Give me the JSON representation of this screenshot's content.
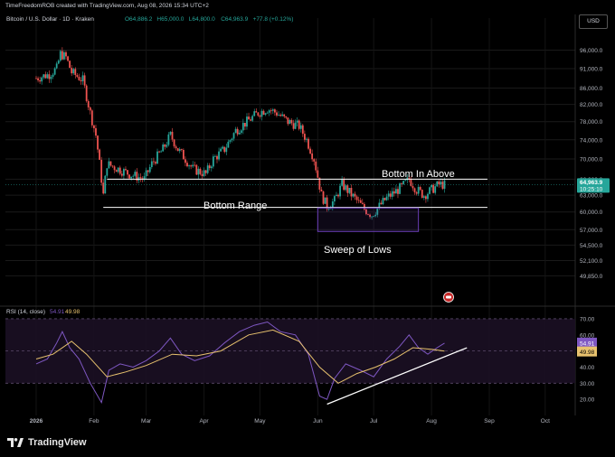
{
  "attribution": "TimeFreedomROB created with TradingView.com, Aug 08, 2026 15:34 UTC+2",
  "currency_button": "USD",
  "legend": {
    "symbol": "Bitcoin / U.S. Dollar · 1D · Kraken",
    "open": "O64,886.2",
    "high": "H65,000.0",
    "low": "L64,800.0",
    "close": "C64,963.9",
    "change": "+77.8 (+0.12%)"
  },
  "price_label": {
    "price": "64,963.9",
    "countdown": "10:25:10"
  },
  "rsi_legend": {
    "name": "RSI (14, close)",
    "rsi_value": "54.91",
    "ma_value": "49.98"
  },
  "rsi_labels": {
    "rsi": "54.91",
    "ma": "49.98"
  },
  "annotations": {
    "bottom_in_above": "Bottom In Above",
    "bottom_range": "Bottom Range",
    "sweep_of_lows": "Sweep of Lows"
  },
  "footer": {
    "brand": "TradingView"
  },
  "colors": {
    "up": "#26a69a",
    "down": "#ef5350",
    "rsi_line": "#7e57c2",
    "rsi_ma": "#e8c26e",
    "sweep_box": "#6b3fb8",
    "price_tag": "#26a69a",
    "rsi_tag": "#7e57c2",
    "ma_tag": "#e8c26e"
  },
  "chart_data": [
    {
      "type": "candlestick",
      "y_scale": "log",
      "ylim": [
        46000,
        100000
      ],
      "y_ticks": [
        "96,000.0",
        "91,000.0",
        "86,000.0",
        "82,000.0",
        "78,000.0",
        "74,000.0",
        "70,000.0",
        "66,000.0",
        "63,000.0",
        "60,000.0",
        "57,000.0",
        "54,500.0",
        "52,100.0",
        "49,850.0"
      ],
      "x_ticks": [
        "2026",
        "Feb",
        "Mar",
        "Apr",
        "May",
        "Jun",
        "Jul",
        "Aug",
        "Sep",
        "Oct"
      ],
      "path_points": [
        {
          "d": "2026-01-01",
          "v": 88500
        },
        {
          "d": "2026-01-08",
          "v": 89500
        },
        {
          "d": "2026-01-12",
          "v": 91000
        },
        {
          "d": "2026-01-14",
          "v": 95000
        },
        {
          "d": "2026-01-17",
          "v": 94000
        },
        {
          "d": "2026-01-20",
          "v": 90000
        },
        {
          "d": "2026-01-26",
          "v": 88000
        },
        {
          "d": "2026-01-30",
          "v": 80000
        },
        {
          "d": "2026-02-02",
          "v": 75000
        },
        {
          "d": "2026-02-06",
          "v": 63000
        },
        {
          "d": "2026-02-08",
          "v": 69000
        },
        {
          "d": "2026-02-14",
          "v": 68000
        },
        {
          "d": "2026-02-20",
          "v": 67000
        },
        {
          "d": "2026-02-28",
          "v": 66000
        },
        {
          "d": "2026-03-04",
          "v": 69000
        },
        {
          "d": "2026-03-10",
          "v": 72000
        },
        {
          "d": "2026-03-14",
          "v": 75000
        },
        {
          "d": "2026-03-18",
          "v": 72000
        },
        {
          "d": "2026-03-26",
          "v": 68000
        },
        {
          "d": "2026-04-02",
          "v": 67000
        },
        {
          "d": "2026-04-06",
          "v": 70000
        },
        {
          "d": "2026-04-12",
          "v": 72000
        },
        {
          "d": "2026-04-18",
          "v": 76000
        },
        {
          "d": "2026-04-24",
          "v": 78000
        },
        {
          "d": "2026-04-30",
          "v": 80000
        },
        {
          "d": "2026-05-05",
          "v": 81000
        },
        {
          "d": "2026-05-10",
          "v": 80000
        },
        {
          "d": "2026-05-16",
          "v": 78000
        },
        {
          "d": "2026-05-22",
          "v": 77000
        },
        {
          "d": "2026-05-26",
          "v": 74000
        },
        {
          "d": "2026-05-30",
          "v": 70000
        },
        {
          "d": "2026-06-03",
          "v": 63000
        },
        {
          "d": "2026-06-06",
          "v": 61000
        },
        {
          "d": "2026-06-10",
          "v": 62000
        },
        {
          "d": "2026-06-14",
          "v": 65000
        },
        {
          "d": "2026-06-18",
          "v": 63500
        },
        {
          "d": "2026-06-22",
          "v": 62000
        },
        {
          "d": "2026-06-26",
          "v": 60500
        },
        {
          "d": "2026-06-30",
          "v": 59500
        },
        {
          "d": "2026-07-04",
          "v": 61000
        },
        {
          "d": "2026-07-08",
          "v": 62500
        },
        {
          "d": "2026-07-12",
          "v": 63500
        },
        {
          "d": "2026-07-16",
          "v": 64500
        },
        {
          "d": "2026-07-20",
          "v": 66000
        },
        {
          "d": "2026-07-24",
          "v": 64000
        },
        {
          "d": "2026-07-28",
          "v": 63000
        },
        {
          "d": "2026-08-01",
          "v": 64000
        },
        {
          "d": "2026-08-05",
          "v": 65000
        },
        {
          "d": "2026-08-08",
          "v": 64963.9
        }
      ],
      "levels": [
        {
          "name": "bottom-in-above-line",
          "price": 66000,
          "from": "2026-02-08",
          "to": "2026-08-31"
        },
        {
          "name": "bottom-range-line",
          "price": 60800,
          "from": "2026-02-06",
          "to": "2026-08-31"
        }
      ],
      "sweep_box": {
        "from": "2026-06-01",
        "to": "2026-07-25",
        "top": 60700,
        "bottom": 56700
      }
    },
    {
      "type": "line",
      "title": "RSI (14, close)",
      "ylim": [
        10,
        75
      ],
      "y_ticks": [
        70,
        60,
        50,
        40,
        30,
        20
      ],
      "bands": [
        30,
        50,
        70
      ],
      "series": [
        {
          "name": "RSI",
          "points": [
            {
              "d": "2026-01-01",
              "v": 42
            },
            {
              "d": "2026-01-07",
              "v": 45
            },
            {
              "d": "2026-01-12",
              "v": 55
            },
            {
              "d": "2026-01-15",
              "v": 62
            },
            {
              "d": "2026-01-19",
              "v": 52
            },
            {
              "d": "2026-01-24",
              "v": 45
            },
            {
              "d": "2026-01-30",
              "v": 30
            },
            {
              "d": "2026-02-05",
              "v": 18
            },
            {
              "d": "2026-02-09",
              "v": 38
            },
            {
              "d": "2026-02-15",
              "v": 42
            },
            {
              "d": "2026-02-22",
              "v": 40
            },
            {
              "d": "2026-03-01",
              "v": 44
            },
            {
              "d": "2026-03-08",
              "v": 50
            },
            {
              "d": "2026-03-14",
              "v": 58
            },
            {
              "d": "2026-03-20",
              "v": 48
            },
            {
              "d": "2026-03-27",
              "v": 44
            },
            {
              "d": "2026-04-04",
              "v": 47
            },
            {
              "d": "2026-04-12",
              "v": 55
            },
            {
              "d": "2026-04-20",
              "v": 62
            },
            {
              "d": "2026-04-28",
              "v": 66
            },
            {
              "d": "2026-05-05",
              "v": 68
            },
            {
              "d": "2026-05-12",
              "v": 62
            },
            {
              "d": "2026-05-20",
              "v": 60
            },
            {
              "d": "2026-05-27",
              "v": 48
            },
            {
              "d": "2026-06-02",
              "v": 22
            },
            {
              "d": "2026-06-06",
              "v": 20
            },
            {
              "d": "2026-06-10",
              "v": 33
            },
            {
              "d": "2026-06-16",
              "v": 42
            },
            {
              "d": "2026-06-24",
              "v": 38
            },
            {
              "d": "2026-07-01",
              "v": 34
            },
            {
              "d": "2026-07-08",
              "v": 45
            },
            {
              "d": "2026-07-15",
              "v": 53
            },
            {
              "d": "2026-07-20",
              "v": 60
            },
            {
              "d": "2026-07-25",
              "v": 52
            },
            {
              "d": "2026-07-30",
              "v": 48
            },
            {
              "d": "2026-08-04",
              "v": 52
            },
            {
              "d": "2026-08-08",
              "v": 54.91
            }
          ]
        },
        {
          "name": "RSI-based MA",
          "points": [
            {
              "d": "2026-01-01",
              "v": 45
            },
            {
              "d": "2026-01-10",
              "v": 48
            },
            {
              "d": "2026-01-20",
              "v": 56
            },
            {
              "d": "2026-01-28",
              "v": 48
            },
            {
              "d": "2026-02-08",
              "v": 34
            },
            {
              "d": "2026-02-18",
              "v": 37
            },
            {
              "d": "2026-03-01",
              "v": 41
            },
            {
              "d": "2026-03-15",
              "v": 48
            },
            {
              "d": "2026-03-28",
              "v": 47
            },
            {
              "d": "2026-04-10",
              "v": 50
            },
            {
              "d": "2026-04-25",
              "v": 60
            },
            {
              "d": "2026-05-08",
              "v": 63
            },
            {
              "d": "2026-05-22",
              "v": 56
            },
            {
              "d": "2026-06-02",
              "v": 40
            },
            {
              "d": "2026-06-12",
              "v": 30
            },
            {
              "d": "2026-06-22",
              "v": 36
            },
            {
              "d": "2026-07-02",
              "v": 40
            },
            {
              "d": "2026-07-12",
              "v": 45
            },
            {
              "d": "2026-07-22",
              "v": 52
            },
            {
              "d": "2026-08-01",
              "v": 51
            },
            {
              "d": "2026-08-08",
              "v": 49.98
            }
          ]
        }
      ],
      "trendline": {
        "from": {
          "d": "2026-06-06",
          "v": 17
        },
        "to": {
          "d": "2026-08-20",
          "v": 52
        }
      }
    }
  ]
}
